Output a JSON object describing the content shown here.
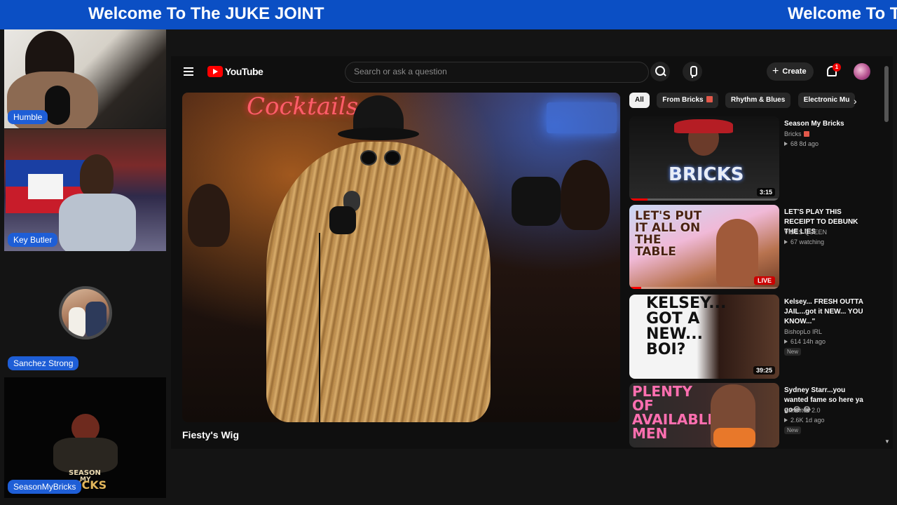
{
  "banner": {
    "text": "Welcome To The JUKE JOINT"
  },
  "participants": [
    {
      "name": "Humble"
    },
    {
      "name": "Key Butler"
    },
    {
      "name": "Sanchez Strong"
    },
    {
      "name": "SeasonMyBricks"
    }
  ],
  "tile4_art": {
    "line1": "SEASON",
    "line2": "MY",
    "line3": "BRICKS"
  },
  "youtube": {
    "wordmark": "YouTube",
    "search": {
      "placeholder": "Search or ask a question"
    },
    "create_label": "Create",
    "notification_count": "1",
    "video": {
      "title": "Fiesty's Wig",
      "neon_sign": "Cocktails"
    },
    "chips": [
      {
        "label": "All",
        "active": true
      },
      {
        "label": "From Bricks",
        "verified": true
      },
      {
        "label": "Rhythm & Blues"
      },
      {
        "label": "Electronic Mu"
      }
    ],
    "recommendations": [
      {
        "title": "Season My Bricks",
        "channel": "Bricks",
        "meta": "68   8d ago",
        "duration": "3:15",
        "thumb_text": "BRICKS",
        "progress": 0.12
      },
      {
        "title": "LET'S PLAY THIS RECEIPT TO DEBUNK THE LIES",
        "channel": "VIBES QUEEN",
        "meta": "67 watching",
        "live_label": "LIVE",
        "thumb_text": "LET'S PUT IT ALL ON THE TABLE",
        "progress": 0.08
      },
      {
        "title": "Kelsey... FRESH OUTTA JAIL...got it NEW... YOU KNOW...\"",
        "channel": "BishopLo IRL",
        "meta": "614   14h ago",
        "badge": "New",
        "duration": "39:25",
        "thumb_text": "KELSEY... GOT A NEW... BOI?"
      },
      {
        "title": "Sydney Starr...you wanted fame so here ya go😂 😂",
        "channel": "Satellites 2.0",
        "meta": "2.6K   1d ago",
        "badge": "New",
        "thumb_text": "PLENTY OF AVAILABLE MEN"
      }
    ]
  }
}
